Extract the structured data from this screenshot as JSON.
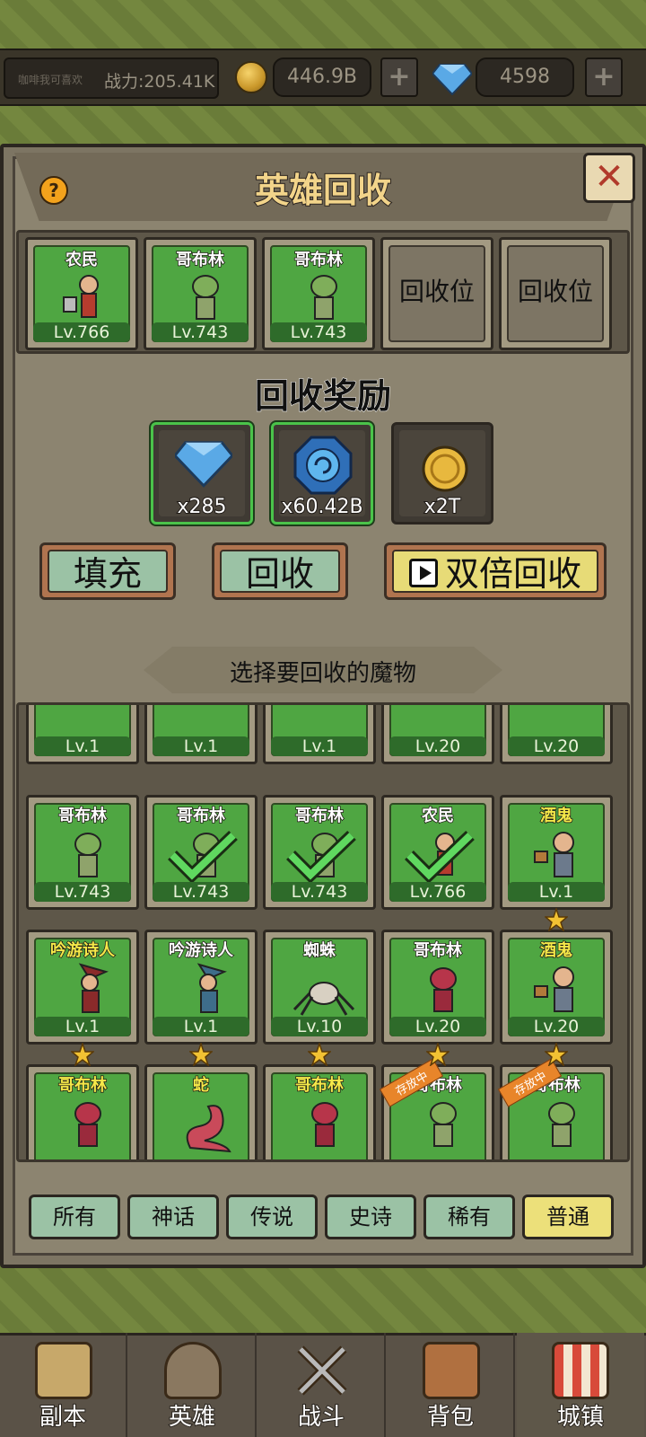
{
  "topbar": {
    "player_name": "咖啡我可喜欢",
    "power": "战力:205.41K",
    "gold": "446.9B",
    "gems": "4598",
    "plus": "+"
  },
  "dialog": {
    "title": "英雄回收",
    "help": "?",
    "close": "✕"
  },
  "slots": [
    {
      "name": "农民",
      "level": "Lv.766"
    },
    {
      "name": "哥布林",
      "level": "Lv.743"
    },
    {
      "name": "哥布林",
      "level": "Lv.743"
    },
    {
      "empty_label": "回收位"
    },
    {
      "empty_label": "回收位"
    }
  ],
  "rewards": {
    "title": "回收奖励",
    "items": [
      {
        "icon": "diamond-icon",
        "count": "x285"
      },
      {
        "icon": "blue-rune-orb-icon",
        "count": "x60.42B"
      },
      {
        "icon": "gold-coin-icon",
        "count": "x2T"
      }
    ]
  },
  "actions": {
    "fill": "填充",
    "recycle": "回收",
    "double": "双倍回收"
  },
  "select_title": "选择要回收的魔物",
  "grid": {
    "row0": [
      {
        "name": "",
        "level": "Lv.1"
      },
      {
        "name": "",
        "level": "Lv.1"
      },
      {
        "name": "",
        "level": "Lv.1"
      },
      {
        "name": "",
        "level": "Lv.20"
      },
      {
        "name": "",
        "level": "Lv.20"
      }
    ],
    "row1": [
      {
        "name": "哥布林",
        "level": "Lv.743",
        "checked": false
      },
      {
        "name": "哥布林",
        "level": "Lv.743",
        "checked": true
      },
      {
        "name": "哥布林",
        "level": "Lv.743",
        "checked": true
      },
      {
        "name": "农民",
        "level": "Lv.766",
        "checked": true
      },
      {
        "name": "酒鬼",
        "level": "Lv.1",
        "checked": false
      }
    ],
    "row2": [
      {
        "name": "吟游诗人",
        "level": "Lv.1"
      },
      {
        "name": "吟游诗人",
        "level": "Lv.1"
      },
      {
        "name": "蜘蛛",
        "level": "Lv.10"
      },
      {
        "name": "哥布林",
        "level": "Lv.20"
      },
      {
        "name": "酒鬼",
        "level": "Lv.20"
      }
    ],
    "row3": [
      {
        "name": "哥布林",
        "level": ""
      },
      {
        "name": "蛇",
        "level": ""
      },
      {
        "name": "哥布林",
        "level": ""
      },
      {
        "name": "哥布林",
        "level": "",
        "tag": "存放中"
      },
      {
        "name": "哥布林",
        "level": "",
        "tag": "存放中"
      }
    ]
  },
  "filters": [
    "所有",
    "神话",
    "传说",
    "史诗",
    "稀有",
    "普通"
  ],
  "active_filter": "普通",
  "nav": [
    "副本",
    "英雄",
    "战斗",
    "背包",
    "城镇"
  ],
  "active_nav": "城镇"
}
